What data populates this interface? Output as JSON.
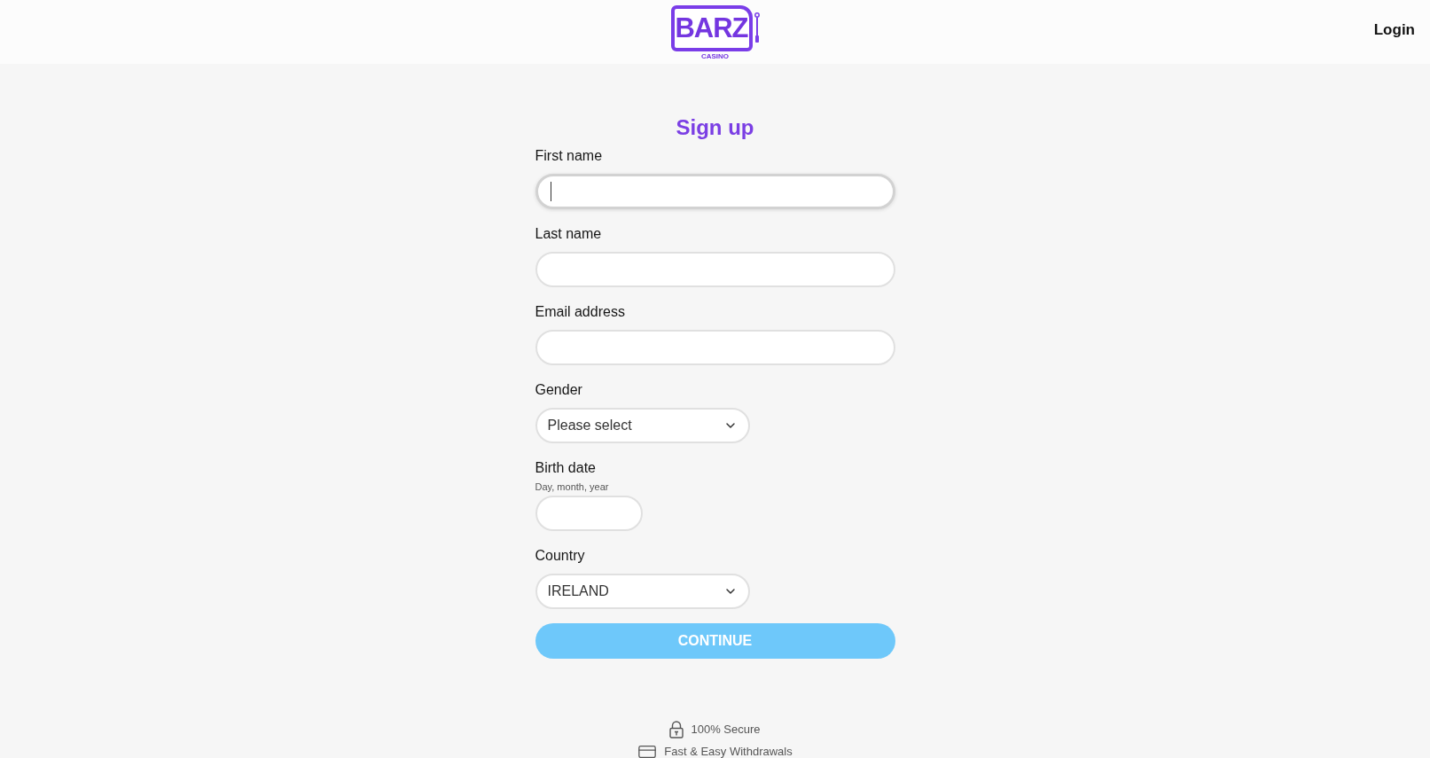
{
  "header": {
    "logo": {
      "wordmark": "BARZ",
      "tagline": "CASINO"
    },
    "login_link": "Login"
  },
  "form": {
    "title": "Sign up",
    "fields": [
      {
        "kind": "text",
        "label": "First name",
        "focused": true
      },
      {
        "kind": "text",
        "label": "Last name",
        "focused": false
      },
      {
        "kind": "text",
        "label": "Email address",
        "focused": false
      },
      {
        "kind": "select",
        "label": "Gender",
        "value": "Please select",
        "focused": false
      },
      {
        "kind": "date",
        "label": "Birth date",
        "hint": "Day, month, year",
        "focused": false
      },
      {
        "kind": "select",
        "label": "Country",
        "value": "IRELAND",
        "focused": false
      }
    ],
    "submit": {
      "label": "CONTINUE",
      "disabled": true
    }
  },
  "trust_badges": [
    {
      "kind": "secure",
      "text": "100% Secure"
    },
    {
      "kind": "withdrawals",
      "text": "Fast & Easy Withdrawals"
    }
  ]
}
